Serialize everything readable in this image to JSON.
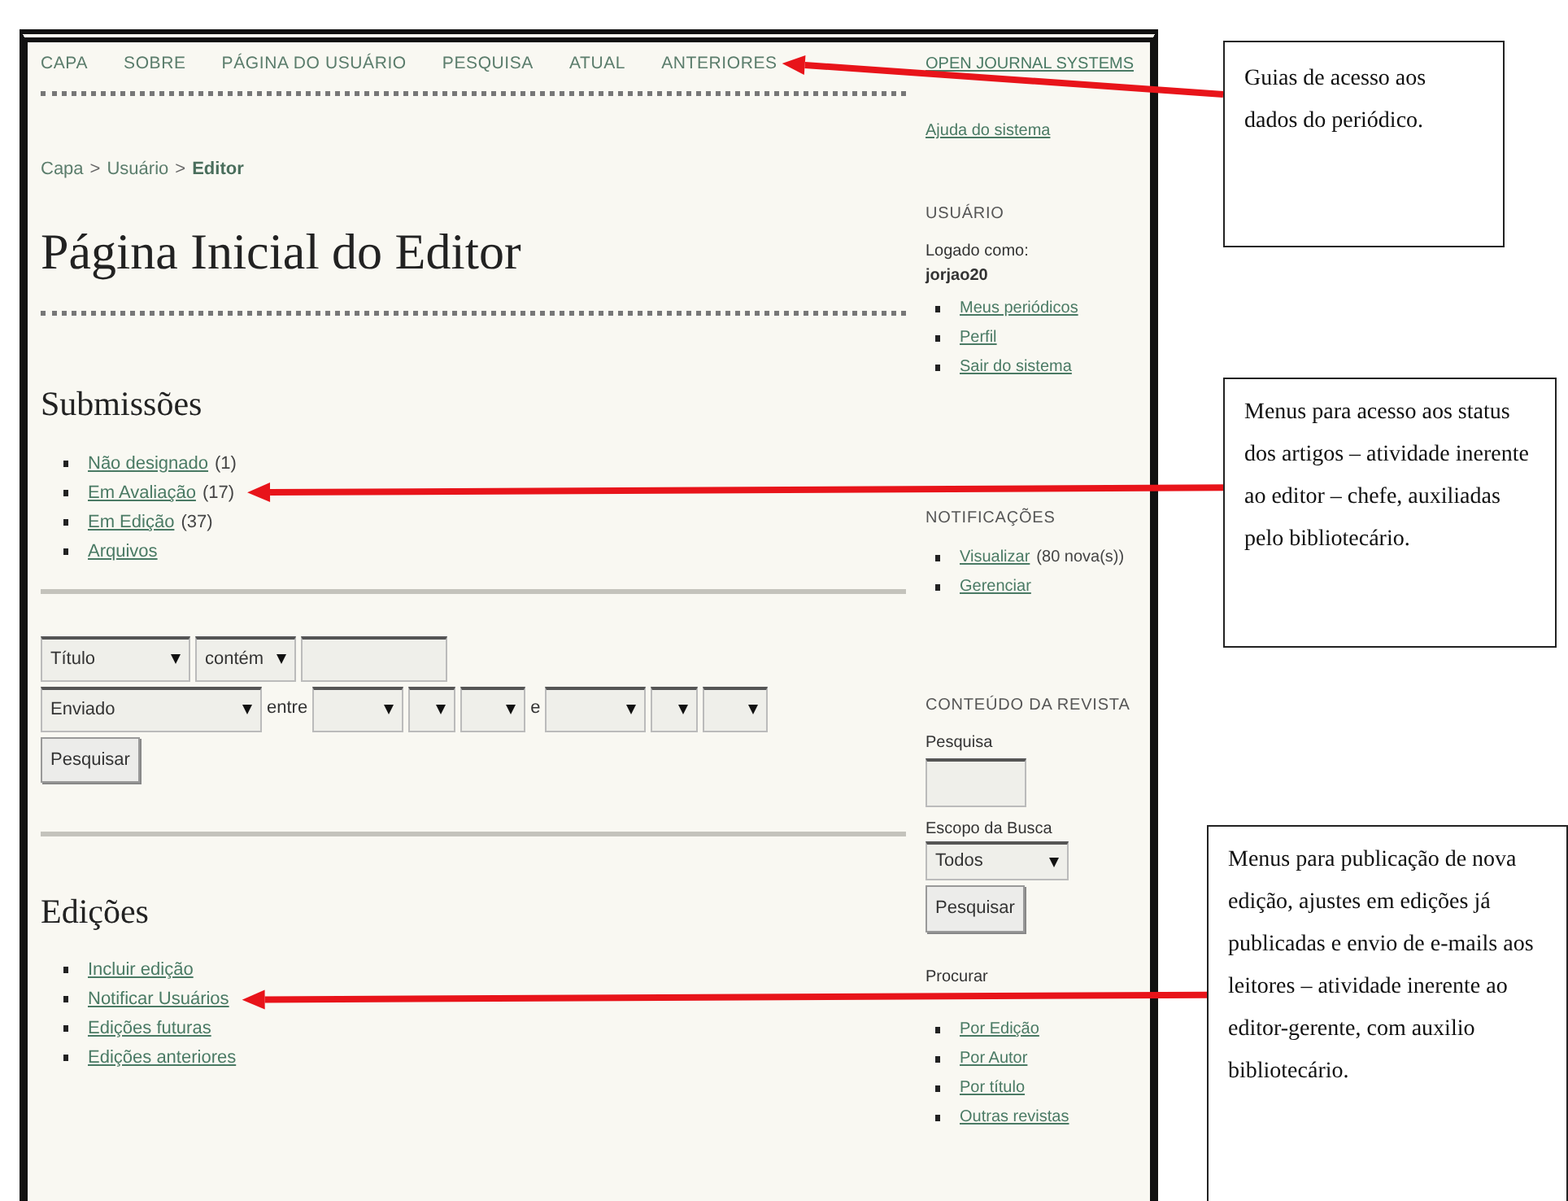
{
  "nav": [
    {
      "label": "CAPA"
    },
    {
      "label": "SOBRE"
    },
    {
      "label": "PÁGINA DO USUÁRIO"
    },
    {
      "label": "PESQUISA"
    },
    {
      "label": "ATUAL"
    },
    {
      "label": "ANTERIORES"
    }
  ],
  "breadcrumb": [
    {
      "kind": "link",
      "text": "Capa"
    },
    {
      "kind": "separator",
      "text": ">"
    },
    {
      "kind": "link",
      "text": "Usuário"
    },
    {
      "kind": "separator",
      "text": ">"
    },
    {
      "kind": "current",
      "text": "Editor"
    }
  ],
  "title": "Página Inicial do Editor",
  "submissions": {
    "heading": "Submissões",
    "items": [
      {
        "link": "Não designado",
        "count": "(1)"
      },
      {
        "link": "Em Avaliação",
        "count": "(17)"
      },
      {
        "link": "Em Edição",
        "count": "(37)"
      },
      {
        "link": "Arquivos"
      }
    ]
  },
  "search_form": {
    "rows": [
      [
        {
          "kind": "select",
          "value": "Título"
        },
        {
          "kind": "select",
          "value": "contém"
        },
        {
          "kind": "input"
        }
      ],
      [
        {
          "kind": "select",
          "value": "Enviado"
        },
        {
          "kind": "text",
          "text": "entre"
        },
        {
          "kind": "select"
        },
        {
          "kind": "select"
        },
        {
          "kind": "select"
        },
        {
          "kind": "text",
          "text": "e"
        },
        {
          "kind": "select"
        },
        {
          "kind": "select"
        },
        {
          "kind": "select"
        }
      ]
    ],
    "button": "Pesquisar"
  },
  "editions": {
    "heading": "Edições",
    "items": [
      {
        "link": "Incluir edição"
      },
      {
        "link": "Notificar Usuários"
      },
      {
        "link": "Edições futuras"
      },
      {
        "link": "Edições anteriores"
      }
    ]
  },
  "sidebar": {
    "brand": "OPEN JOURNAL SYSTEMS",
    "help": "Ajuda do sistema",
    "user": {
      "heading": "USUÁRIO",
      "logged_label": "Logado como:",
      "username": "jorjao20",
      "links": [
        "Meus periódicos",
        "Perfil",
        "Sair do sistema"
      ]
    },
    "notifications": {
      "heading": "NOTIFICAÇÕES",
      "items": [
        {
          "link": "Visualizar",
          "note": "(80 nova(s))"
        },
        {
          "link": "Gerenciar"
        }
      ]
    },
    "content": {
      "heading": "CONTEÚDO DA REVISTA",
      "search_label": "Pesquisa",
      "scope_label": "Escopo da Busca",
      "scope_value": "Todos",
      "button": "Pesquisar",
      "browse_heading": "Procurar",
      "browse_links": [
        "Por Edição",
        "Por Autor",
        "Por título",
        "Outras revistas"
      ]
    }
  },
  "annotations": [
    {
      "text": "Guias de acesso aos dados do periódico."
    },
    {
      "text": "Menus para acesso aos status dos artigos – atividade inerente ao editor – chefe, auxiliadas pelo bibliotecário."
    },
    {
      "text": "Menus para publicação de nova edição, ajustes em edições já publicadas e envio de e-mails aos leitores – atividade inerente ao editor-gerente, com auxilio bibliotecário."
    }
  ]
}
